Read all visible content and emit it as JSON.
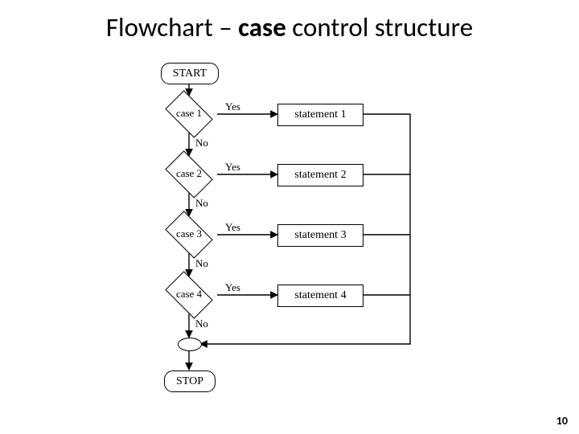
{
  "page": {
    "title_pre": "Flowchart – ",
    "title_emph": "case",
    "title_post": " control structure",
    "number": "10"
  },
  "flow": {
    "start": "START",
    "stop": "STOP",
    "yes": "Yes",
    "no": "No",
    "cases": [
      {
        "label": "case 1",
        "stmt": "statement 1"
      },
      {
        "label": "case 2",
        "stmt": "statement 2"
      },
      {
        "label": "case 3",
        "stmt": "statement 3"
      },
      {
        "label": "case 4",
        "stmt": "statement 4"
      }
    ]
  }
}
